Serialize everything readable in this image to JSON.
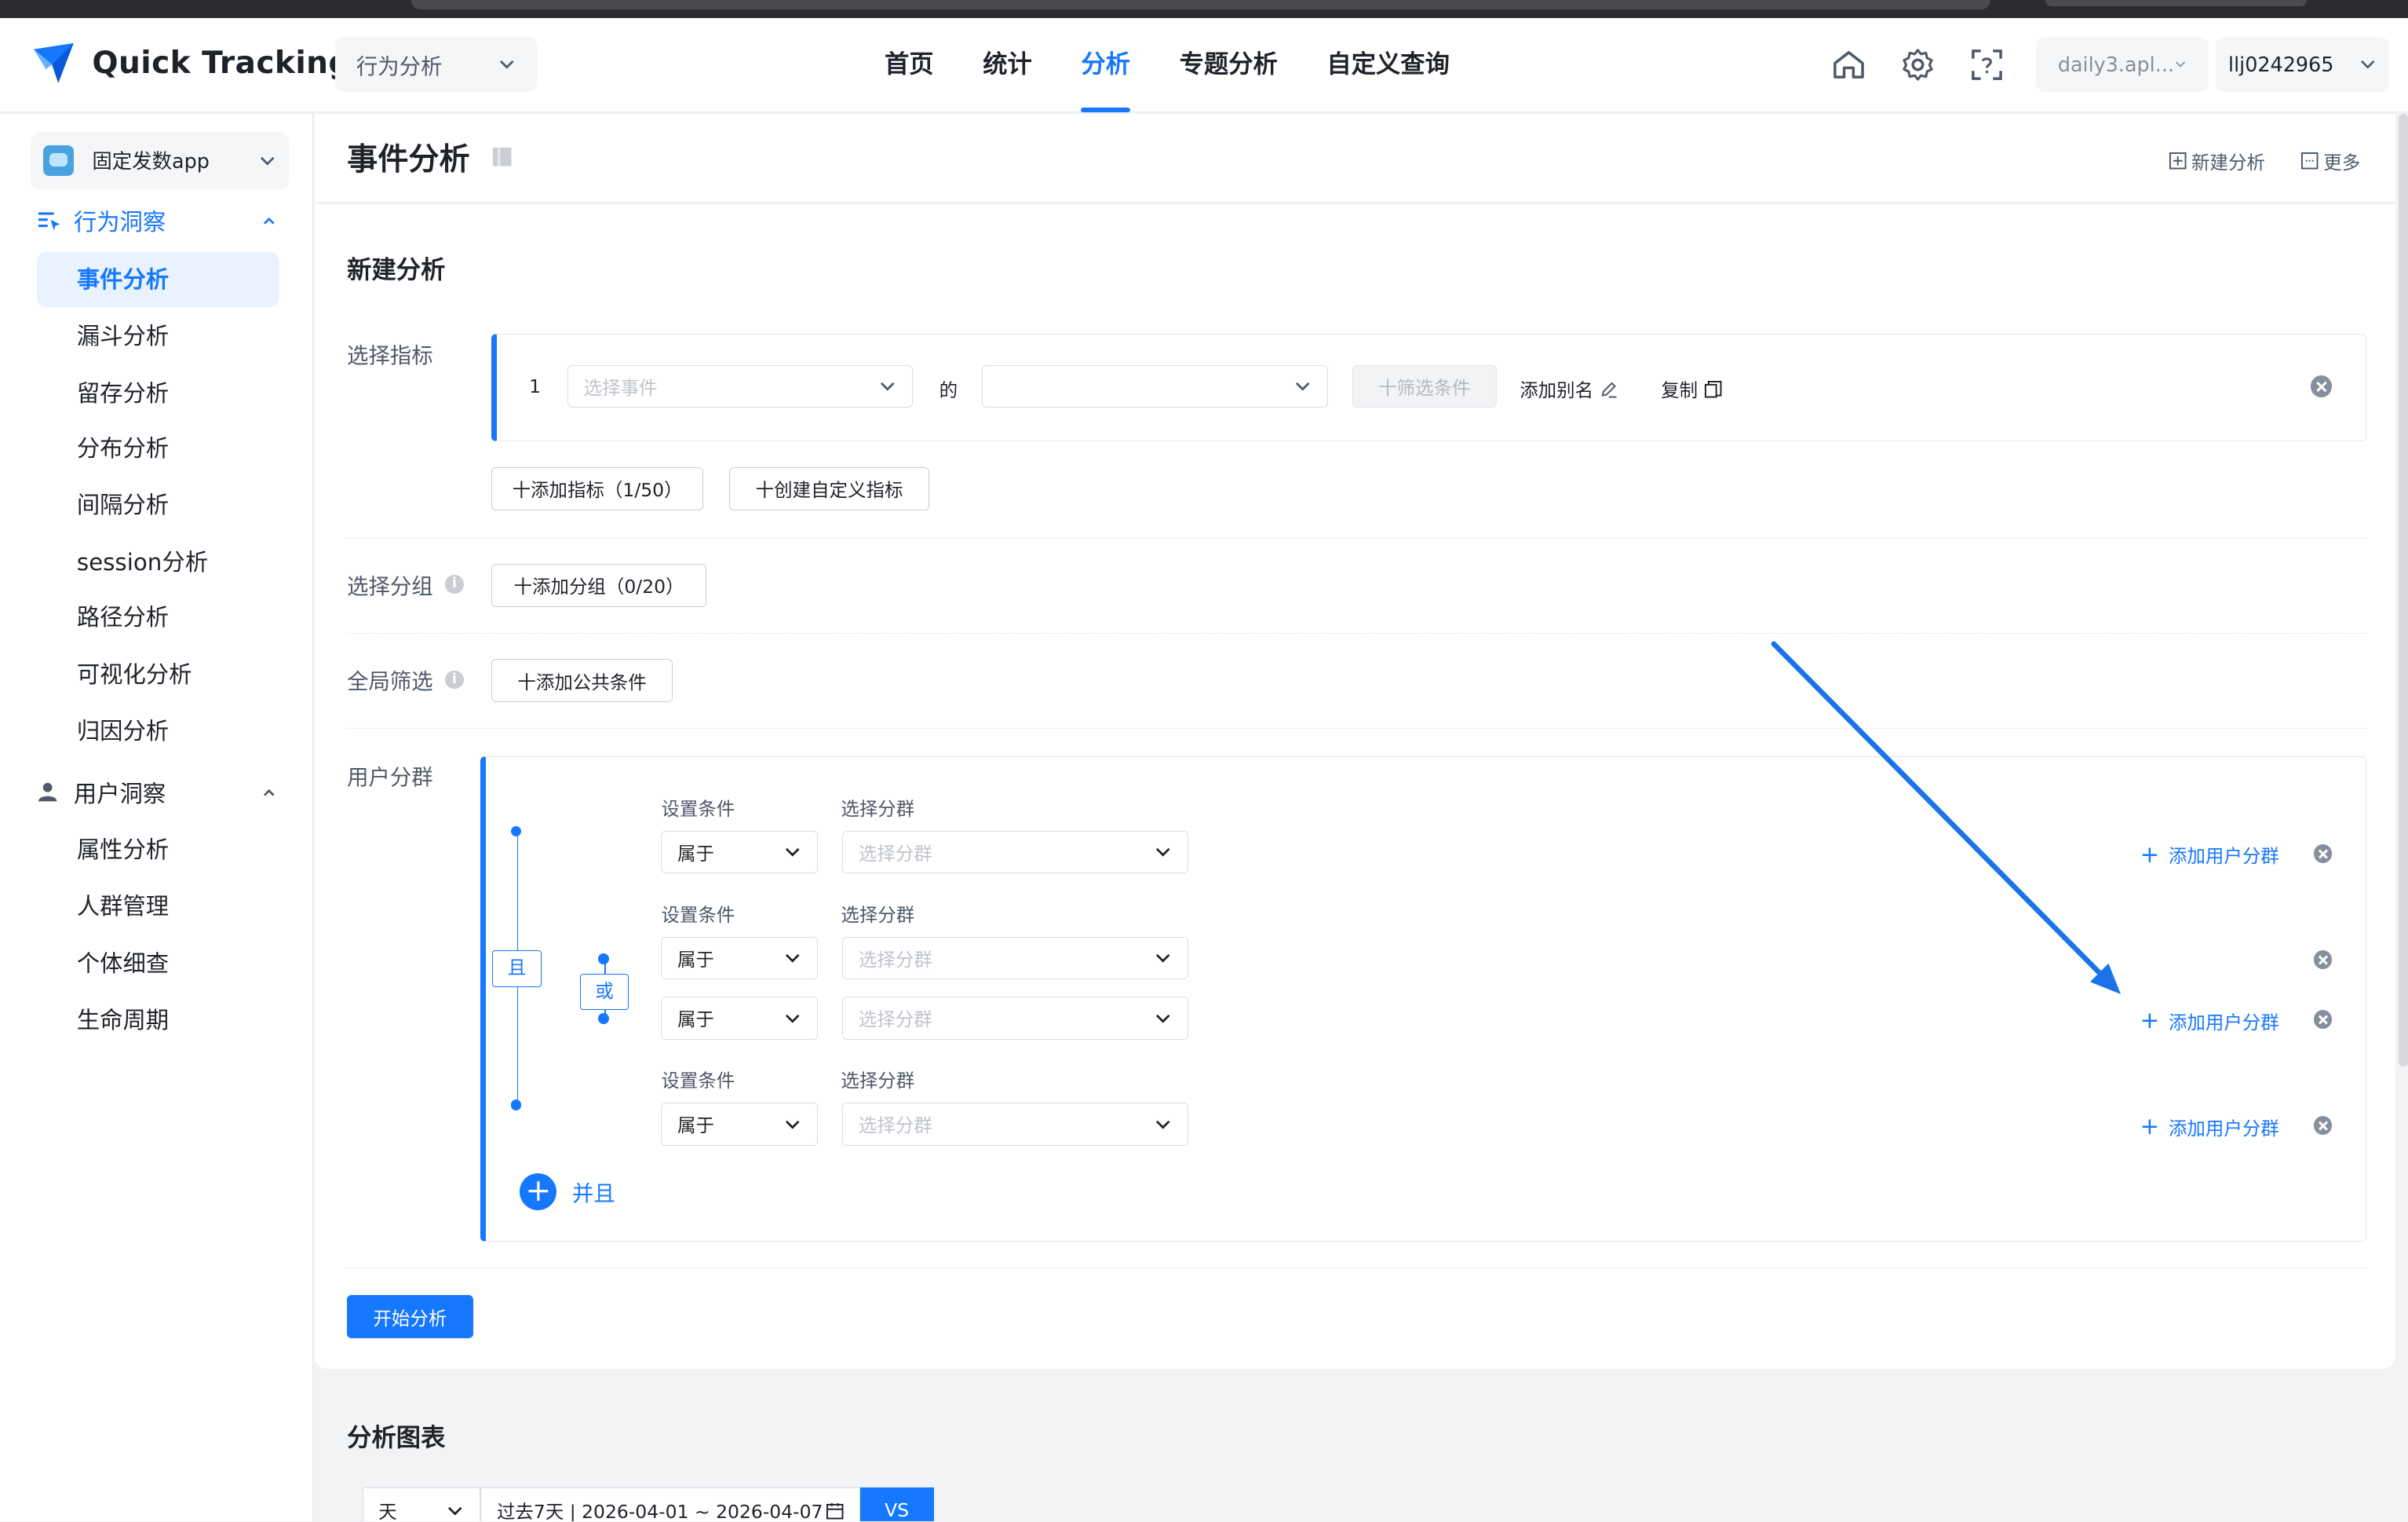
{
  "app": {
    "logo_text": "Quick Tracking",
    "module": "行为分析",
    "app_switch": "daily3.apl...",
    "user": "llj0242965"
  },
  "nav": [
    "首页",
    "统计",
    "分析",
    "专题分析",
    "自定义查询"
  ],
  "header_icons": [
    "home-icon",
    "settings-icon",
    "help-scan-icon"
  ],
  "sidebar": {
    "app_picker": "固定发数app",
    "group1": {
      "label": "行为洞察",
      "items": [
        "事件分析",
        "漏斗分析",
        "留存分析",
        "分布分析",
        "间隔分析",
        "session分析",
        "路径分析",
        "可视化分析",
        "归因分析"
      ]
    },
    "group2": {
      "label": "用户洞察",
      "items": [
        "属性分析",
        "人群管理",
        "个体细查",
        "生命周期"
      ]
    }
  },
  "page": {
    "title": "事件分析",
    "new_analysis": "新建分析",
    "more": "更多"
  },
  "form": {
    "section_title": "新建分析",
    "metric_label": "选择指标",
    "metric_index": "1",
    "event_placeholder": "选择事件",
    "of_word": "的",
    "filter_btn": "十筛选条件",
    "alias": "添加别名",
    "copy": "复制",
    "add_metric": "十添加指标（1/50）",
    "create_custom": "十创建自定义指标",
    "group_label": "选择分组",
    "add_group": "十添加分组（0/20）",
    "global_label": "全局筛选",
    "add_common": "十添加公共条件",
    "segment_label": "用户分群",
    "cond_label": "设置条件",
    "seg_select_label": "选择分群",
    "belongs": "属于",
    "seg_placeholder": "选择分群",
    "add_user_seg": "添加用户分群",
    "and_logic": "且",
    "or_logic": "或",
    "and_add": "并且",
    "start": "开始分析"
  },
  "chart_area": {
    "title": "分析图表",
    "granularity": "天",
    "range": "过去7天 | 2026-04-01 ~ 2026-04-07",
    "vs": "VS"
  },
  "colors": {
    "accent": "#1677ff",
    "annotation_arrow": "#1a73e8"
  }
}
